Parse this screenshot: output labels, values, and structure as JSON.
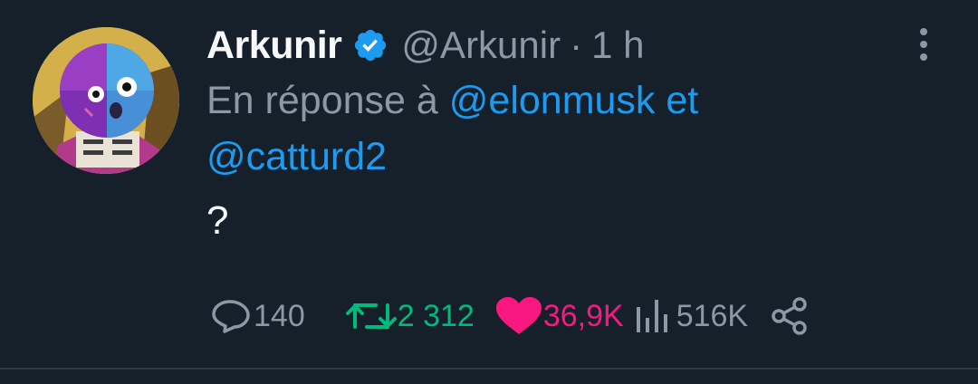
{
  "author": {
    "name": "Arkunir",
    "handle": "@Arkunir",
    "separator": "·",
    "time": "1 h",
    "verified": true
  },
  "reply_context": {
    "prefix": "En réponse à",
    "mention1": "@elonmusk",
    "conjunction": "et",
    "mention2": "@catturd2"
  },
  "body": "?",
  "stats": {
    "replies": "140",
    "retweets": "2 312",
    "likes": "36,9K",
    "views": "516K"
  },
  "colors": {
    "background": "#15202b",
    "text": "#f7f9f9",
    "secondary": "#8b98a5",
    "link": "#1d9bf0",
    "retweet": "#00ba7c",
    "like": "#f91880"
  },
  "icons": [
    "verified-badge-icon",
    "more-options-icon",
    "reply-icon",
    "retweet-icon",
    "like-heart-icon",
    "views-icon",
    "share-icon"
  ]
}
